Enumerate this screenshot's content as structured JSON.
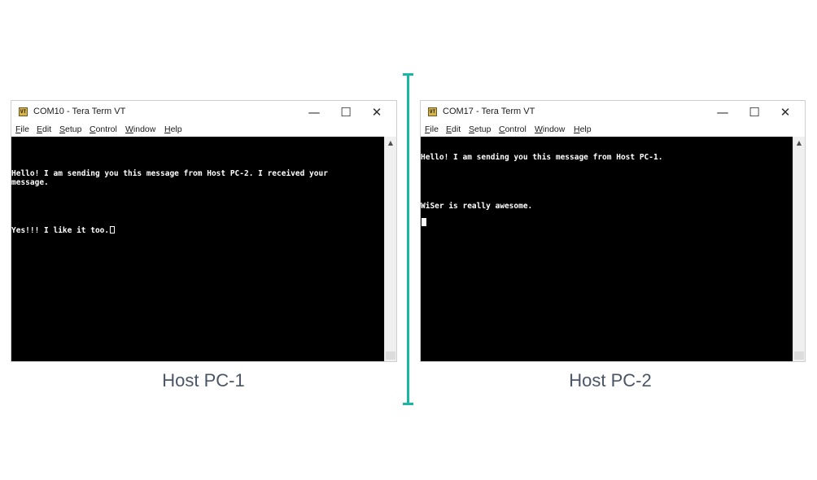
{
  "colors": {
    "divider": "#19b7a0",
    "terminal_bg": "#000000",
    "terminal_fg": "#ffffff",
    "caption": "#4a5566"
  },
  "window_controls": {
    "minimize": "—",
    "maximize": "☐",
    "close": "✕",
    "scroll_up": "▲"
  },
  "app_icon_text": "VT",
  "windows": [
    {
      "title": "COM10 - Tera Term VT",
      "menu": [
        {
          "mnemonic": "F",
          "rest": "ile"
        },
        {
          "mnemonic": "E",
          "rest": "dit"
        },
        {
          "mnemonic": "S",
          "rest": "etup"
        },
        {
          "mnemonic": "C",
          "rest": "ontrol"
        },
        {
          "mnemonic": "W",
          "rest": "indow"
        },
        {
          "mnemonic": "H",
          "rest": "elp"
        }
      ],
      "lines": [
        "Hello! I am sending you this message from Host PC-2. I received your",
        "message.",
        "Yes!!! I like it too."
      ],
      "caption": "Host PC-1"
    },
    {
      "title": "COM17 - Tera Term VT",
      "menu": [
        {
          "mnemonic": "F",
          "rest": "ile"
        },
        {
          "mnemonic": "E",
          "rest": "dit"
        },
        {
          "mnemonic": "S",
          "rest": "etup"
        },
        {
          "mnemonic": "C",
          "rest": "ontrol"
        },
        {
          "mnemonic": "W",
          "rest": "indow"
        },
        {
          "mnemonic": "H",
          "rest": "elp"
        }
      ],
      "lines": [
        "Hello! I am sending you this message from Host PC-1.",
        "WiSer is really awesome."
      ],
      "caption": "Host PC-2"
    }
  ]
}
